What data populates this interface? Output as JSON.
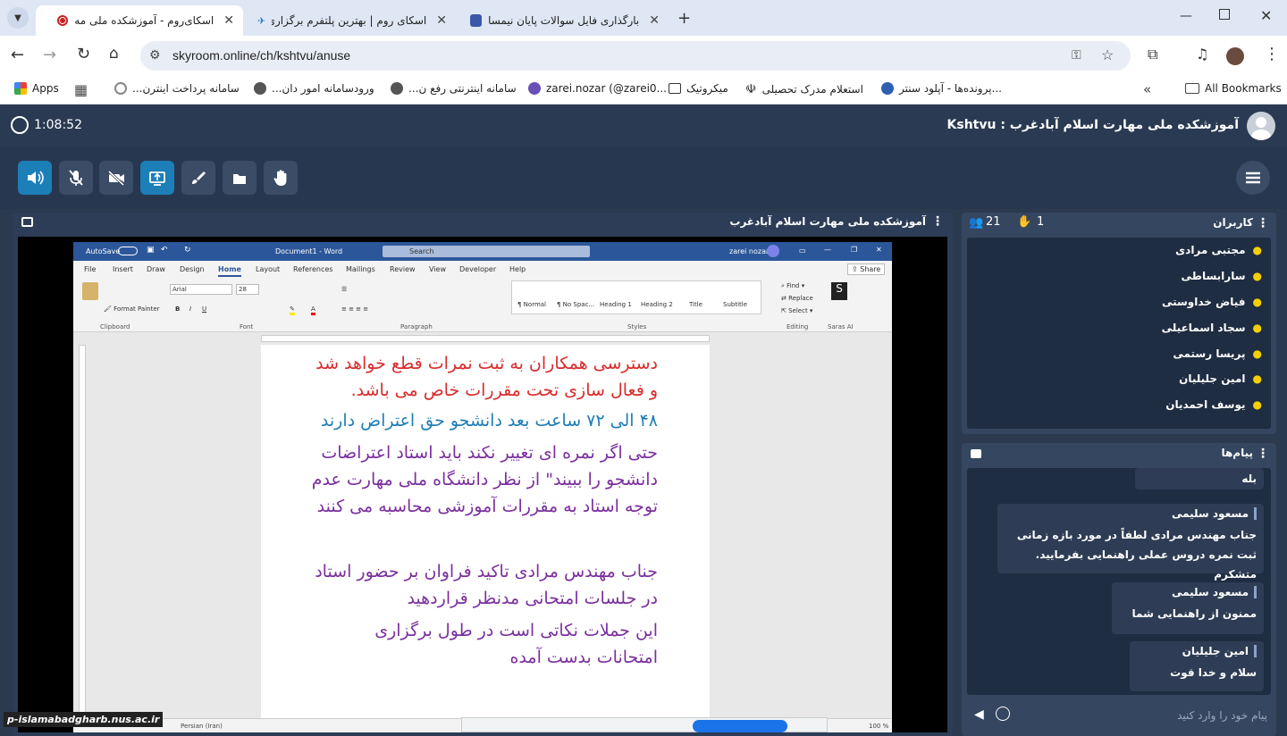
{
  "browser": {
    "tabs": [
      {
        "title": "اسکای‌روم - آموزشکده ملی مه",
        "active": true
      },
      {
        "title": "اسکای روم | بهترین پلتفرم برگزاری",
        "active": false
      },
      {
        "title": "بارگذاری فایل سوالات پایان نیمسال",
        "active": false
      }
    ],
    "url": "skyroom.online/ch/kshtvu/anuse",
    "bookmarks": [
      {
        "label": "Apps"
      },
      {
        "label": "سامانه پرداخت اینترن..."
      },
      {
        "label": "ورودسامانه امور دان..."
      },
      {
        "label": "سامانه اینترنتی رفع ن..."
      },
      {
        "label": "zarei.nozar (@zarei0..."
      },
      {
        "label": "میکروتیک"
      },
      {
        "label": "استعلام مدرک تحصیلی"
      },
      {
        "label": "پرونده‌ها - آپلود سنتر..."
      }
    ],
    "all_bookmarks": "All Bookmarks"
  },
  "room": {
    "timer": "1:08:52",
    "title": "Kshtvu : آموزشکده ملی مهارت اسلام آبادغرب",
    "stage_title": "آموزشکده ملی مهارت اسلام آبادغرب",
    "accent": "#1d7fb8"
  },
  "users_panel": {
    "title": "کاربران",
    "user_count": "21",
    "hand_count": "1",
    "users": [
      "مجتبی مرادی",
      "سارابساطی",
      "فیاض خداوستی",
      "سجاد اسماعیلی",
      "پریسا رستمی",
      "امین جلیلیان",
      "یوسف احمدیان"
    ]
  },
  "messages_panel": {
    "title": "پیام‌ها",
    "messages": [
      {
        "name": "",
        "text": "بله"
      },
      {
        "name": "مسعود سلیمی",
        "text": "جناب مهندس مرادی لطفاً در مورد بازه زمانی ثبت نمره دروس عملی راهنمایی بفرمایید. متشکرم"
      },
      {
        "name": "مسعود سلیمی",
        "text": "ممنون از راهنمایی شما"
      },
      {
        "name": "امین جلیلیان",
        "text": "سلام و خدا قوت"
      }
    ],
    "input_placeholder": "پیام خود را وارد کنید"
  },
  "word": {
    "autosave": "AutoSave",
    "doc_title": "Document1 - Word",
    "search": "Search",
    "user": "zarei nozar",
    "share": "Share",
    "tabs": [
      "File",
      "Insert",
      "Draw",
      "Design",
      "Home",
      "Layout",
      "References",
      "Mailings",
      "Review",
      "View",
      "Developer",
      "Help"
    ],
    "active_tab": "Home",
    "font": "Arial",
    "size": "28",
    "styles": [
      "¶ Normal",
      "¶ No Spac...",
      "Heading 1",
      "Heading 2",
      "Title",
      "Subtitle"
    ],
    "groups": [
      "Clipboard",
      "Font",
      "Paragraph",
      "Styles",
      "Editing",
      "Saras AI"
    ],
    "lines": [
      {
        "text": "دسترسی همکاران به ثبت نمرات قطع خواهد شد",
        "color": "red"
      },
      {
        "text": "و فعال سازی تحت مقررات خاص می باشد.",
        "color": "red"
      },
      {
        "text": "۴۸ الی ۷۲ ساعت بعد دانشجو حق اعتراض دارند",
        "color": "teal"
      },
      {
        "text": "حتی اگر نمره ای تغییر نکند باید استاد اعتراضات",
        "color": "purple"
      },
      {
        "text": "دانشجو را ببیند\" از نظر دانشگاه ملی مهارت عدم",
        "color": "purple"
      },
      {
        "text": "توجه استاد به مقررات آموزشی محاسبه می کنند",
        "color": "purple"
      },
      {
        "text": "جناب مهندس مرادی تاکید فراوان بر حضور استاد",
        "color": "purple"
      },
      {
        "text": "در جلسات امتحانی مدنظر قراردهید",
        "color": "purple"
      },
      {
        "text": "این جملات نکاتی است در طول برگزاری",
        "color": "purple"
      },
      {
        "text": "امتحانات بدست آمده",
        "color": "purple"
      }
    ],
    "status_lang": "Persian (Iran)",
    "zoom": "100 %"
  },
  "watermark": "p-islamabadgharb.nus.ac.ir"
}
